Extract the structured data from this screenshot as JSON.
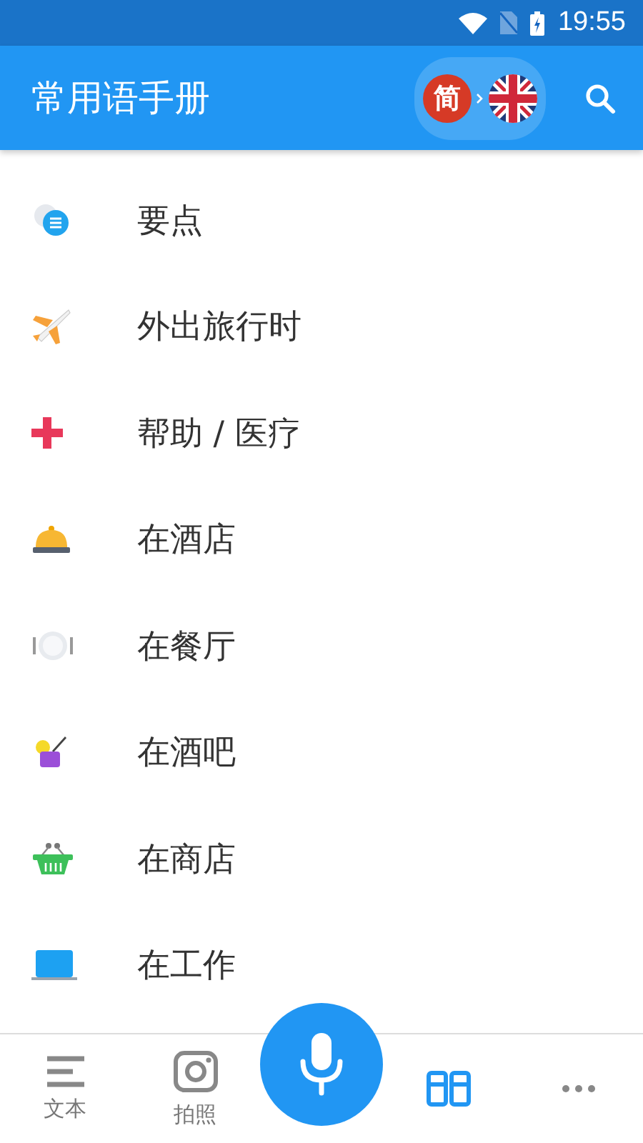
{
  "status_bar": {
    "time": "19:55"
  },
  "app_bar": {
    "title": "常用语手册",
    "language": {
      "source": "简"
    }
  },
  "categories": [
    {
      "label": "要点",
      "kind": "chat"
    },
    {
      "label": "外出旅行时",
      "kind": "plane"
    },
    {
      "label": "帮助 / 医疗",
      "kind": "cross"
    },
    {
      "label": "在酒店",
      "kind": "bell"
    },
    {
      "label": "在餐厅",
      "kind": "plate"
    },
    {
      "label": "在酒吧",
      "kind": "drink"
    },
    {
      "label": "在商店",
      "kind": "basket"
    },
    {
      "label": "在工作",
      "kind": "laptop"
    }
  ],
  "bottom_nav": [
    {
      "label": "文本",
      "kind": "text",
      "selected": false
    },
    {
      "label": "拍照",
      "kind": "camera",
      "selected": false
    },
    {
      "kind": "mic",
      "selected": false
    },
    {
      "kind": "book",
      "selected": true
    },
    {
      "kind": "more",
      "selected": false
    }
  ]
}
